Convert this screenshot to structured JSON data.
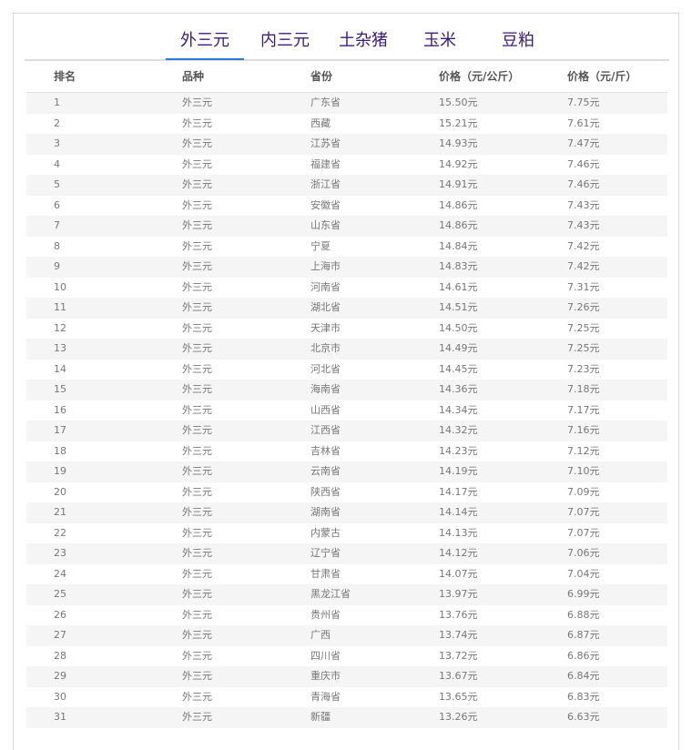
{
  "tabs": [
    {
      "label": "外三元",
      "active": true
    },
    {
      "label": "内三元",
      "active": false
    },
    {
      "label": "土杂猪",
      "active": false
    },
    {
      "label": "玉米",
      "active": false
    },
    {
      "label": "豆粕",
      "active": false
    }
  ],
  "table": {
    "headers": [
      "排名",
      "品种",
      "省份",
      "价格（元/公斤）",
      "价格（元/斤）"
    ],
    "rows": [
      [
        "1",
        "外三元",
        "广东省",
        "15.50元",
        "7.75元"
      ],
      [
        "2",
        "外三元",
        "西藏",
        "15.21元",
        "7.61元"
      ],
      [
        "3",
        "外三元",
        "江苏省",
        "14.93元",
        "7.47元"
      ],
      [
        "4",
        "外三元",
        "福建省",
        "14.92元",
        "7.46元"
      ],
      [
        "5",
        "外三元",
        "浙江省",
        "14.91元",
        "7.46元"
      ],
      [
        "6",
        "外三元",
        "安徽省",
        "14.86元",
        "7.43元"
      ],
      [
        "7",
        "外三元",
        "山东省",
        "14.86元",
        "7.43元"
      ],
      [
        "8",
        "外三元",
        "宁夏",
        "14.84元",
        "7.42元"
      ],
      [
        "9",
        "外三元",
        "上海市",
        "14.83元",
        "7.42元"
      ],
      [
        "10",
        "外三元",
        "河南省",
        "14.61元",
        "7.31元"
      ],
      [
        "11",
        "外三元",
        "湖北省",
        "14.51元",
        "7.26元"
      ],
      [
        "12",
        "外三元",
        "天津市",
        "14.50元",
        "7.25元"
      ],
      [
        "13",
        "外三元",
        "北京市",
        "14.49元",
        "7.25元"
      ],
      [
        "14",
        "外三元",
        "河北省",
        "14.45元",
        "7.23元"
      ],
      [
        "15",
        "外三元",
        "海南省",
        "14.36元",
        "7.18元"
      ],
      [
        "16",
        "外三元",
        "山西省",
        "14.34元",
        "7.17元"
      ],
      [
        "17",
        "外三元",
        "江西省",
        "14.32元",
        "7.16元"
      ],
      [
        "18",
        "外三元",
        "吉林省",
        "14.23元",
        "7.12元"
      ],
      [
        "19",
        "外三元",
        "云南省",
        "14.19元",
        "7.10元"
      ],
      [
        "20",
        "外三元",
        "陕西省",
        "14.17元",
        "7.09元"
      ],
      [
        "21",
        "外三元",
        "湖南省",
        "14.14元",
        "7.07元"
      ],
      [
        "22",
        "外三元",
        "内蒙古",
        "14.13元",
        "7.07元"
      ],
      [
        "23",
        "外三元",
        "辽宁省",
        "14.12元",
        "7.06元"
      ],
      [
        "24",
        "外三元",
        "甘肃省",
        "14.07元",
        "7.04元"
      ],
      [
        "25",
        "外三元",
        "黑龙江省",
        "13.97元",
        "6.99元"
      ],
      [
        "26",
        "外三元",
        "贵州省",
        "13.76元",
        "6.88元"
      ],
      [
        "27",
        "外三元",
        "广西",
        "13.74元",
        "6.87元"
      ],
      [
        "28",
        "外三元",
        "四川省",
        "13.72元",
        "6.86元"
      ],
      [
        "29",
        "外三元",
        "重庆市",
        "13.67元",
        "6.84元"
      ],
      [
        "30",
        "外三元",
        "青海省",
        "13.65元",
        "6.83元"
      ],
      [
        "31",
        "外三元",
        "新疆",
        "13.26元",
        "6.63元"
      ]
    ]
  },
  "colors": {
    "tab_text": "#3c1a7a",
    "tab_active_underline": "#2a7bd8"
  }
}
